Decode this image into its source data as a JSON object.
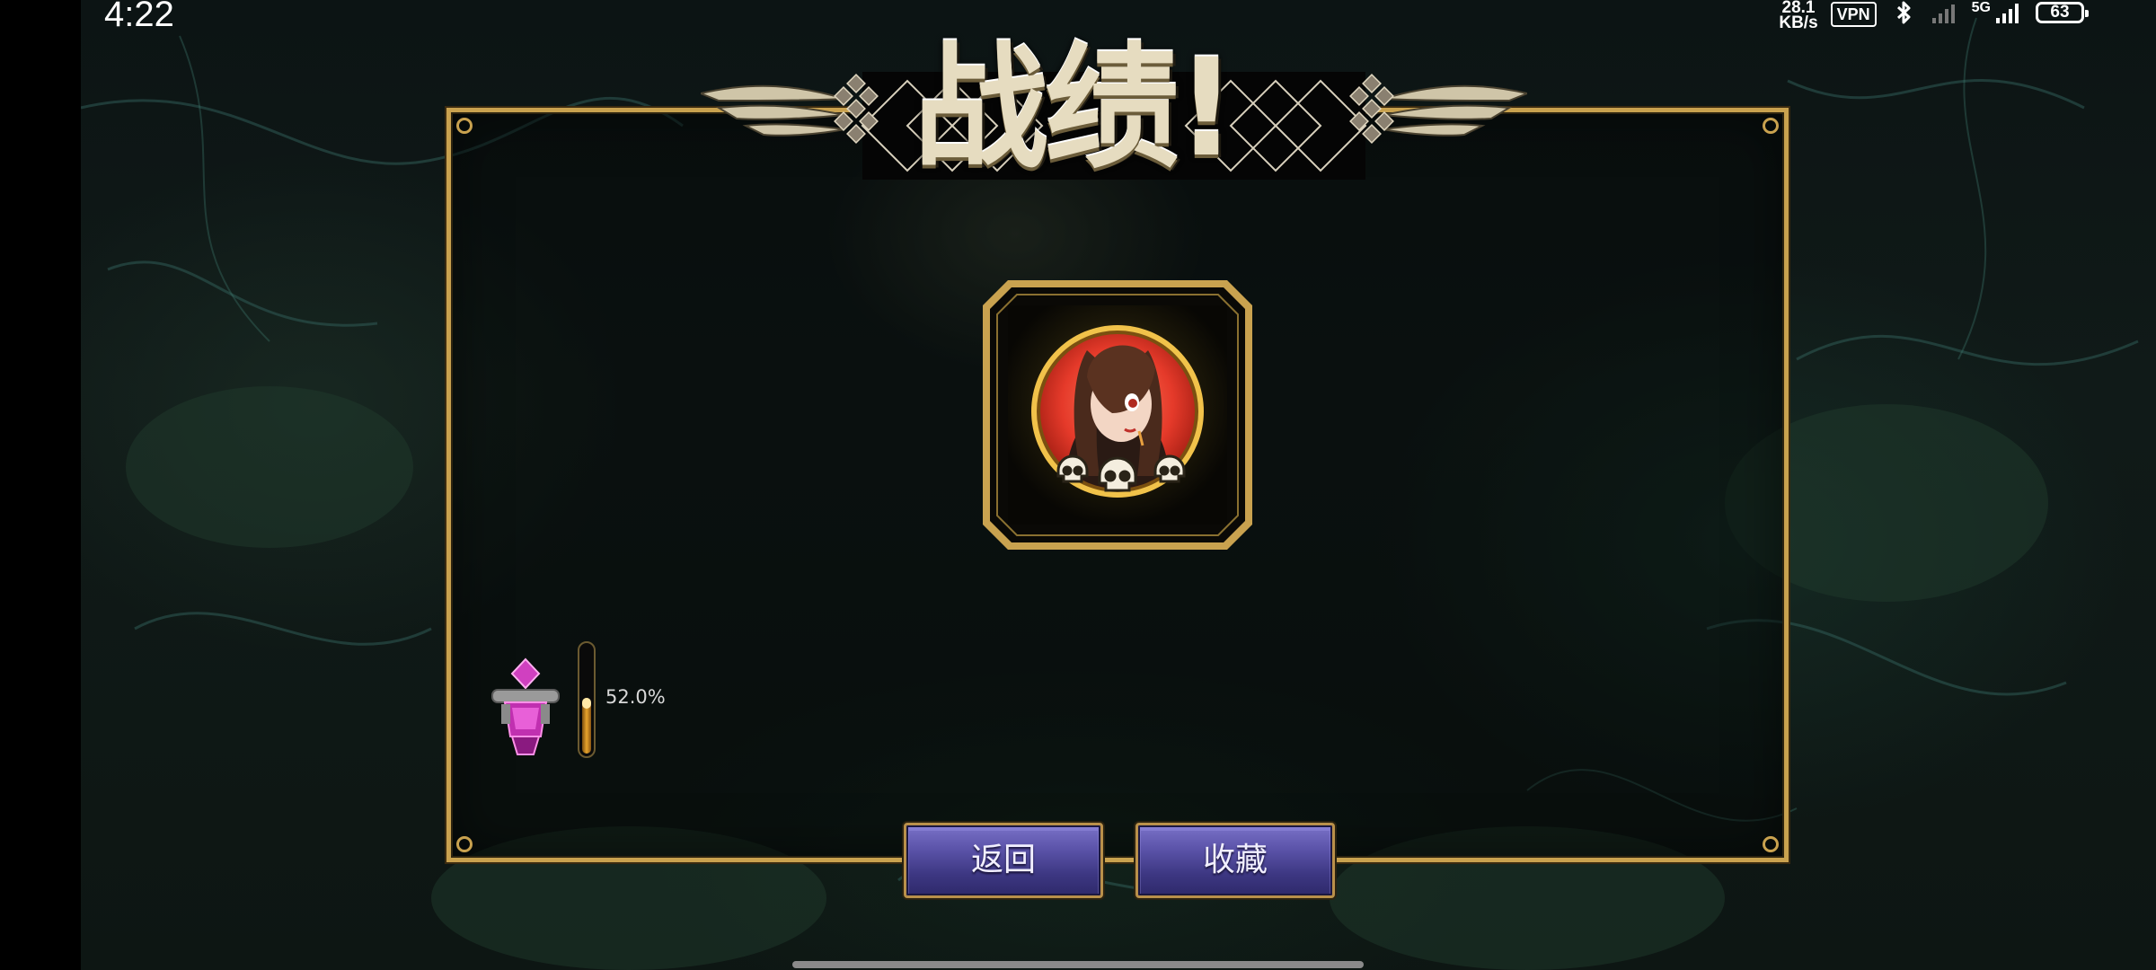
{
  "status_bar": {
    "time": "4:22",
    "net_speed_value": "28.1",
    "net_speed_unit": "KB/s",
    "vpn_label": "VPN",
    "network_type": "5G",
    "battery_level": "63"
  },
  "result_screen": {
    "title": "战绩!",
    "character": {
      "portrait": "character-portrait",
      "skull_count": 3,
      "ring_color": "#e53a2a",
      "frame_color": "#c9a24f"
    },
    "collection": {
      "icon": "pink-trophy-icon",
      "progress_fraction": 0.52,
      "progress_text": "52.0%"
    },
    "buttons": {
      "back_label": "返回",
      "collect_label": "收藏"
    }
  },
  "colors": {
    "gold_border": "#c9a24f",
    "button_purple": "#4a43a0",
    "background": "#0f1816"
  }
}
